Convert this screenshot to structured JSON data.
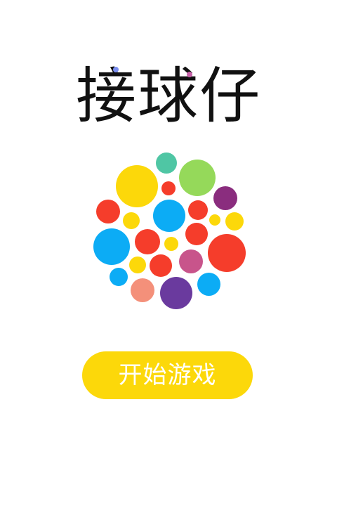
{
  "title": "接球仔",
  "start_button": {
    "label": "开始游戏",
    "color": "#fcd80a"
  },
  "balls": [
    {
      "name": "ball-teal",
      "color": "#4fc6a4"
    },
    {
      "name": "ball-yellow-large",
      "color": "#fcd80a"
    },
    {
      "name": "ball-green",
      "color": "#95d95a"
    },
    {
      "name": "ball-red-small",
      "color": "#f53d2b"
    },
    {
      "name": "ball-purple",
      "color": "#8a2d7e"
    },
    {
      "name": "ball-red-left",
      "color": "#f53d2b"
    },
    {
      "name": "ball-yellow-small",
      "color": "#fcd80a"
    },
    {
      "name": "ball-blue-center",
      "color": "#0cacf5"
    },
    {
      "name": "ball-red-right",
      "color": "#f53d2b"
    },
    {
      "name": "ball-yellow-right-small",
      "color": "#fcd80a"
    },
    {
      "name": "ball-yellow-right",
      "color": "#fcd80a"
    },
    {
      "name": "ball-blue-left",
      "color": "#0cacf5"
    },
    {
      "name": "ball-red-middle",
      "color": "#f53d2b"
    },
    {
      "name": "ball-yellow-center",
      "color": "#fcd80a"
    },
    {
      "name": "ball-red-mid-right",
      "color": "#f53d2b"
    },
    {
      "name": "ball-red-large-right",
      "color": "#f53d2b"
    },
    {
      "name": "ball-yellow-low",
      "color": "#fcd80a"
    },
    {
      "name": "ball-red-low",
      "color": "#f53d2b"
    },
    {
      "name": "ball-pink",
      "color": "#c8548b"
    },
    {
      "name": "ball-blue-small-left",
      "color": "#0cacf5"
    },
    {
      "name": "ball-salmon",
      "color": "#f4907a"
    },
    {
      "name": "ball-indigo",
      "color": "#6a3a9e"
    },
    {
      "name": "ball-blue-right",
      "color": "#0cacf5"
    }
  ]
}
